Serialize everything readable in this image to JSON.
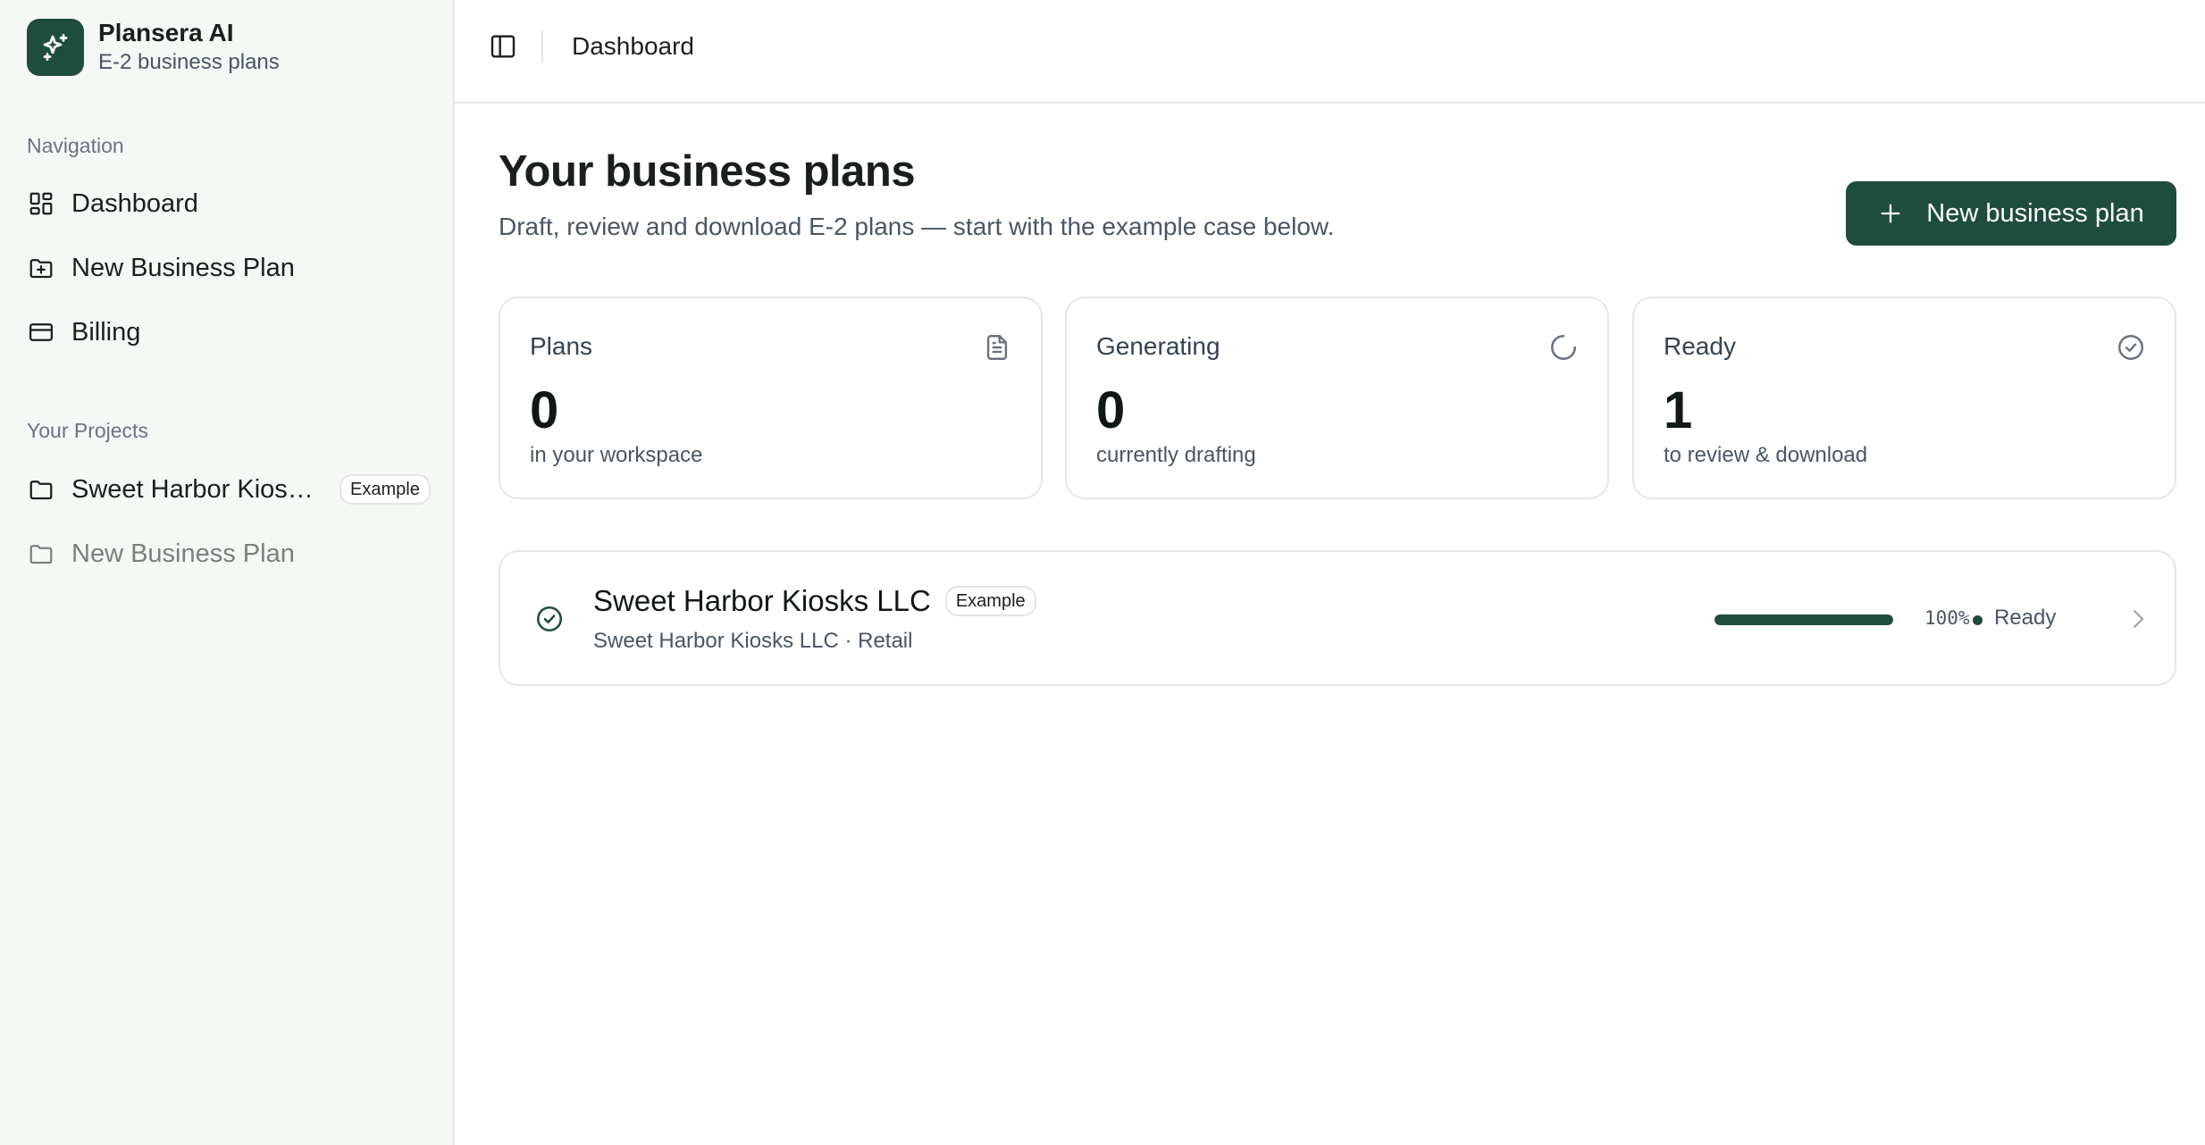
{
  "brand": {
    "name": "Plansera AI",
    "subtitle": "E-2 business plans"
  },
  "sidebar": {
    "nav_label": "Navigation",
    "nav_items": [
      {
        "label": "Dashboard",
        "icon": "dashboard-grid-icon"
      },
      {
        "label": "New Business Plan",
        "icon": "folder-plus-icon"
      },
      {
        "label": "Billing",
        "icon": "credit-card-icon"
      }
    ],
    "projects_label": "Your Projects",
    "projects": [
      {
        "label": "Sweet Harbor Kiosks LLC",
        "badge": "Example",
        "icon": "folder-icon"
      },
      {
        "label": "New Business Plan",
        "icon": "folder-icon"
      }
    ]
  },
  "topbar": {
    "breadcrumb": "Dashboard",
    "toggle_icon": "sidebar-toggle-icon"
  },
  "header": {
    "title": "Your business plans",
    "subtitle": "Draft, review and download E-2 plans — start with the example case below.",
    "new_button_label": "New business plan"
  },
  "stats": [
    {
      "title": "Plans",
      "value": "0",
      "caption": "in your workspace",
      "icon": "file-text-icon"
    },
    {
      "title": "Generating",
      "value": "0",
      "caption": "currently drafting",
      "icon": "loader-icon"
    },
    {
      "title": "Ready",
      "value": "1",
      "caption": "to review & download",
      "icon": "check-circle-icon"
    }
  ],
  "plans": [
    {
      "name": "Sweet Harbor Kiosks LLC",
      "badge": "Example",
      "meta": "Sweet Harbor Kiosks LLC · Retail",
      "progress": 100,
      "progress_label": "100%",
      "status": "Ready"
    }
  ],
  "colors": {
    "accent": "#1f4d3d",
    "sidebar_bg": "#f6f8f6",
    "border": "#e5e7e6"
  }
}
